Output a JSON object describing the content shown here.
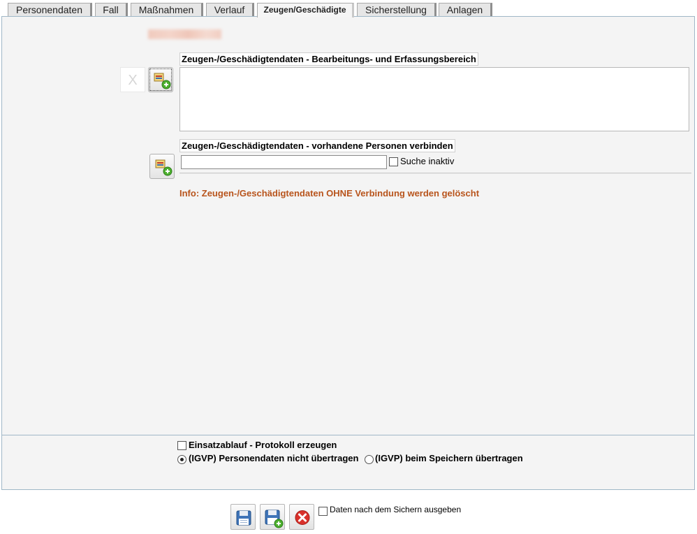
{
  "tabs": [
    {
      "label": "Personendaten",
      "active": false
    },
    {
      "label": "Fall",
      "active": false
    },
    {
      "label": "Maßnahmen",
      "active": false
    },
    {
      "label": "Verlauf",
      "active": false
    },
    {
      "label": "Zeugen/Geschädigte",
      "active": true
    },
    {
      "label": "Sicherstellung",
      "active": false
    },
    {
      "label": "Anlagen",
      "active": false
    }
  ],
  "editing": {
    "section_title": "Zeugen-/Geschädigtendaten - Bearbeitungs- und Erfassungsbereich",
    "delete_label": "X",
    "add_icon": "add-person-icon"
  },
  "connect": {
    "section_title": "Zeugen-/Geschädigtendaten - vorhandene Personen verbinden",
    "search_value": "",
    "search_inactive_label": "Suche inaktiv",
    "search_inactive_checked": false,
    "add_icon": "add-person-icon"
  },
  "info_text": "Info: Zeugen-/Geschädigtendaten OHNE Verbindung werden gelöscht",
  "bottom": {
    "protocol_label": "Einsatzablauf - Protokoll erzeugen",
    "protocol_checked": false,
    "radio_options": [
      {
        "label": "(IGVP) Personendaten nicht übertragen",
        "checked": true
      },
      {
        "label": "(IGVP) beim Speichern übertragen",
        "checked": false
      }
    ]
  },
  "actions": {
    "save_icon": "save-icon",
    "save_new_icon": "save-and-add-icon",
    "cancel_icon": "cancel-icon",
    "output_label": "Daten nach dem Sichern ausgeben",
    "output_checked": false
  },
  "colors": {
    "info": "#b8541c",
    "panel_bg": "#f4f4f4",
    "panel_border": "#9fb7c7",
    "cancel_red": "#d9312b",
    "add_green": "#4caf2e"
  }
}
